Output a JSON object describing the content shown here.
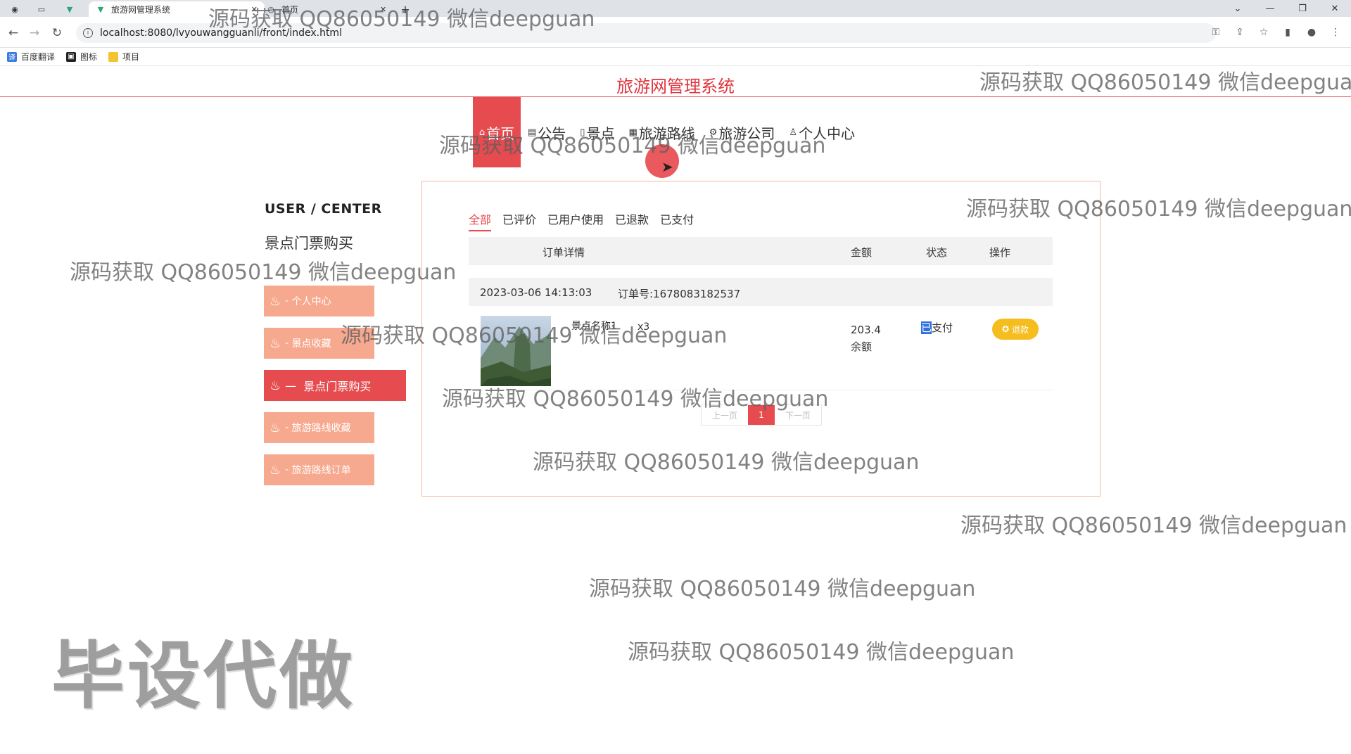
{
  "browser": {
    "tab_title": "旅游网管理系统",
    "tab2_title": "首页",
    "url": "localhost:8080/lvyouwangguanli/front/index.html",
    "bookmarks": [
      "百度翻译",
      "图标",
      "项目"
    ]
  },
  "site": {
    "title": "旅游网管理系统",
    "nav": [
      {
        "label": "首页",
        "icon": "home-icon"
      },
      {
        "label": "公告",
        "icon": "notice-icon"
      },
      {
        "label": "景点",
        "icon": "scenic-icon"
      },
      {
        "label": "旅游路线",
        "icon": "route-icon"
      },
      {
        "label": "旅游公司",
        "icon": "company-icon"
      },
      {
        "label": "个人中心",
        "icon": "user-icon"
      }
    ]
  },
  "sidebar": {
    "heading": "USER / CENTER",
    "subheading": "景点门票购买",
    "items": [
      {
        "label": "个人中心",
        "prefix": "-"
      },
      {
        "label": "景点收藏",
        "prefix": "-"
      },
      {
        "label": "景点门票购买",
        "prefix": "—"
      },
      {
        "label": "旅游路线收藏",
        "prefix": "-"
      },
      {
        "label": "旅游路线订单",
        "prefix": "-"
      }
    ],
    "active_index": 2
  },
  "orders": {
    "tabs": [
      "全部",
      "已评价",
      "已用户使用",
      "已退款",
      "已支付"
    ],
    "active_tab": 0,
    "columns": [
      "订单详情",
      "金额",
      "状态",
      "操作"
    ],
    "order": {
      "datetime": "2023-03-06 14:13:03",
      "order_no": "订单号:1678083182537",
      "product_name": "景点名称1",
      "qty": "x3",
      "amount": "203.4",
      "pay_method": "余额",
      "status_sel": "已",
      "status_rest": "支付",
      "action": "退款"
    },
    "pager": {
      "prev": "上一页",
      "current": "1",
      "next": "下一页"
    }
  },
  "watermarks": {
    "text": "源码获取 QQ86050149 微信deepguan",
    "stamp": "毕设代做"
  },
  "colors": {
    "accent": "#e54b4f",
    "sidebar_item": "#f7a98f",
    "refund_button": "#f5bd1e",
    "panel_border": "#f3b9a3"
  }
}
